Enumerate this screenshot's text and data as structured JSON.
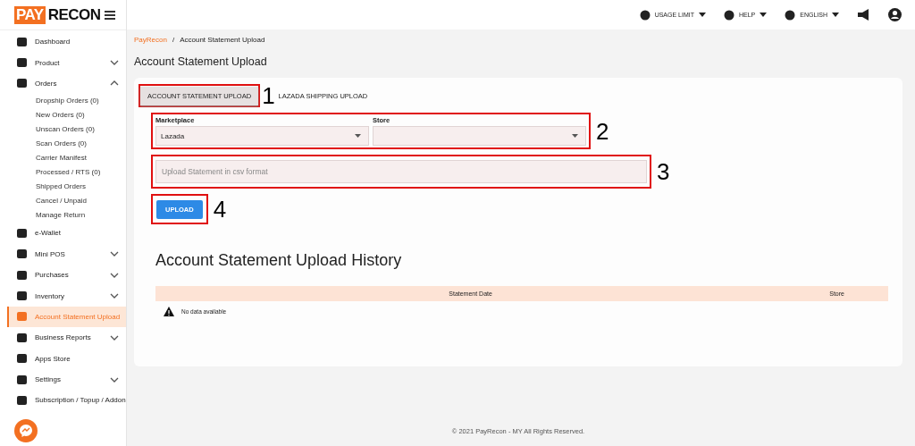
{
  "logo": {
    "part_1": "PAY",
    "part_2": "RECON"
  },
  "topbar": [
    {
      "label": "USAGE LIMIT",
      "dropdown": true
    },
    {
      "label": "HELP",
      "dropdown": true
    },
    {
      "label": "ENGLISH",
      "dropdown": true
    }
  ],
  "sidebar": {
    "items": [
      {
        "label": "Dashboard",
        "selected": false
      },
      {
        "label": "Product",
        "selected": false,
        "expanded": false
      },
      {
        "label": "Orders",
        "selected": false,
        "expanded": true,
        "children": [
          {
            "label": "Dropship Orders (0)"
          },
          {
            "label": "New Orders (0)"
          },
          {
            "label": "Unscan Orders (0)"
          },
          {
            "label": "Scan Orders (0)"
          },
          {
            "label": "Carrier Manifest"
          },
          {
            "label": "Processed / RTS (0)"
          },
          {
            "label": "Shipped Orders"
          },
          {
            "label": "Cancel / Unpaid"
          },
          {
            "label": "Manage Return"
          }
        ]
      },
      {
        "label": "e-Wallet",
        "selected": false
      },
      {
        "label": "Mini POS",
        "selected": false,
        "expanded": false
      },
      {
        "label": "Purchases",
        "selected": false,
        "expanded": false
      },
      {
        "label": "Inventory",
        "selected": false,
        "expanded": false
      },
      {
        "label": "Account Statement Upload",
        "selected": true
      },
      {
        "label": "Business Reports",
        "selected": false,
        "expanded": false
      },
      {
        "label": "Apps Store",
        "selected": false
      },
      {
        "label": "Settings",
        "selected": false,
        "expanded": false
      },
      {
        "label": "Subscription / Topup / Addon",
        "selected": false
      }
    ]
  },
  "breadcrumb": [
    "PayRecon",
    "/",
    "Account Statement Upload"
  ],
  "page_title": "Account Statement Upload",
  "tabs": {
    "callout": "1",
    "items": [
      {
        "label": "ACCOUNT STATEMENT UPLOAD",
        "selected": true
      },
      {
        "label": "LAZADA SHIPPING UPLOAD",
        "selected": false
      }
    ]
  },
  "selects": {
    "callout": "2",
    "fields": [
      {
        "label": "Marketplace",
        "value": "Lazada"
      },
      {
        "label": "Store"
      }
    ]
  },
  "file_field": {
    "callout": "3",
    "placeholder": "Upload Statement in csv format"
  },
  "upload_button": {
    "callout": "4",
    "label": "UPLOAD"
  },
  "history": {
    "title": "Account Statement Upload History",
    "columns": [
      "Statement Date",
      "Store"
    ],
    "empty": "No data available"
  },
  "footer": "© 2021 PayRecon - MY All Rights Reserved."
}
